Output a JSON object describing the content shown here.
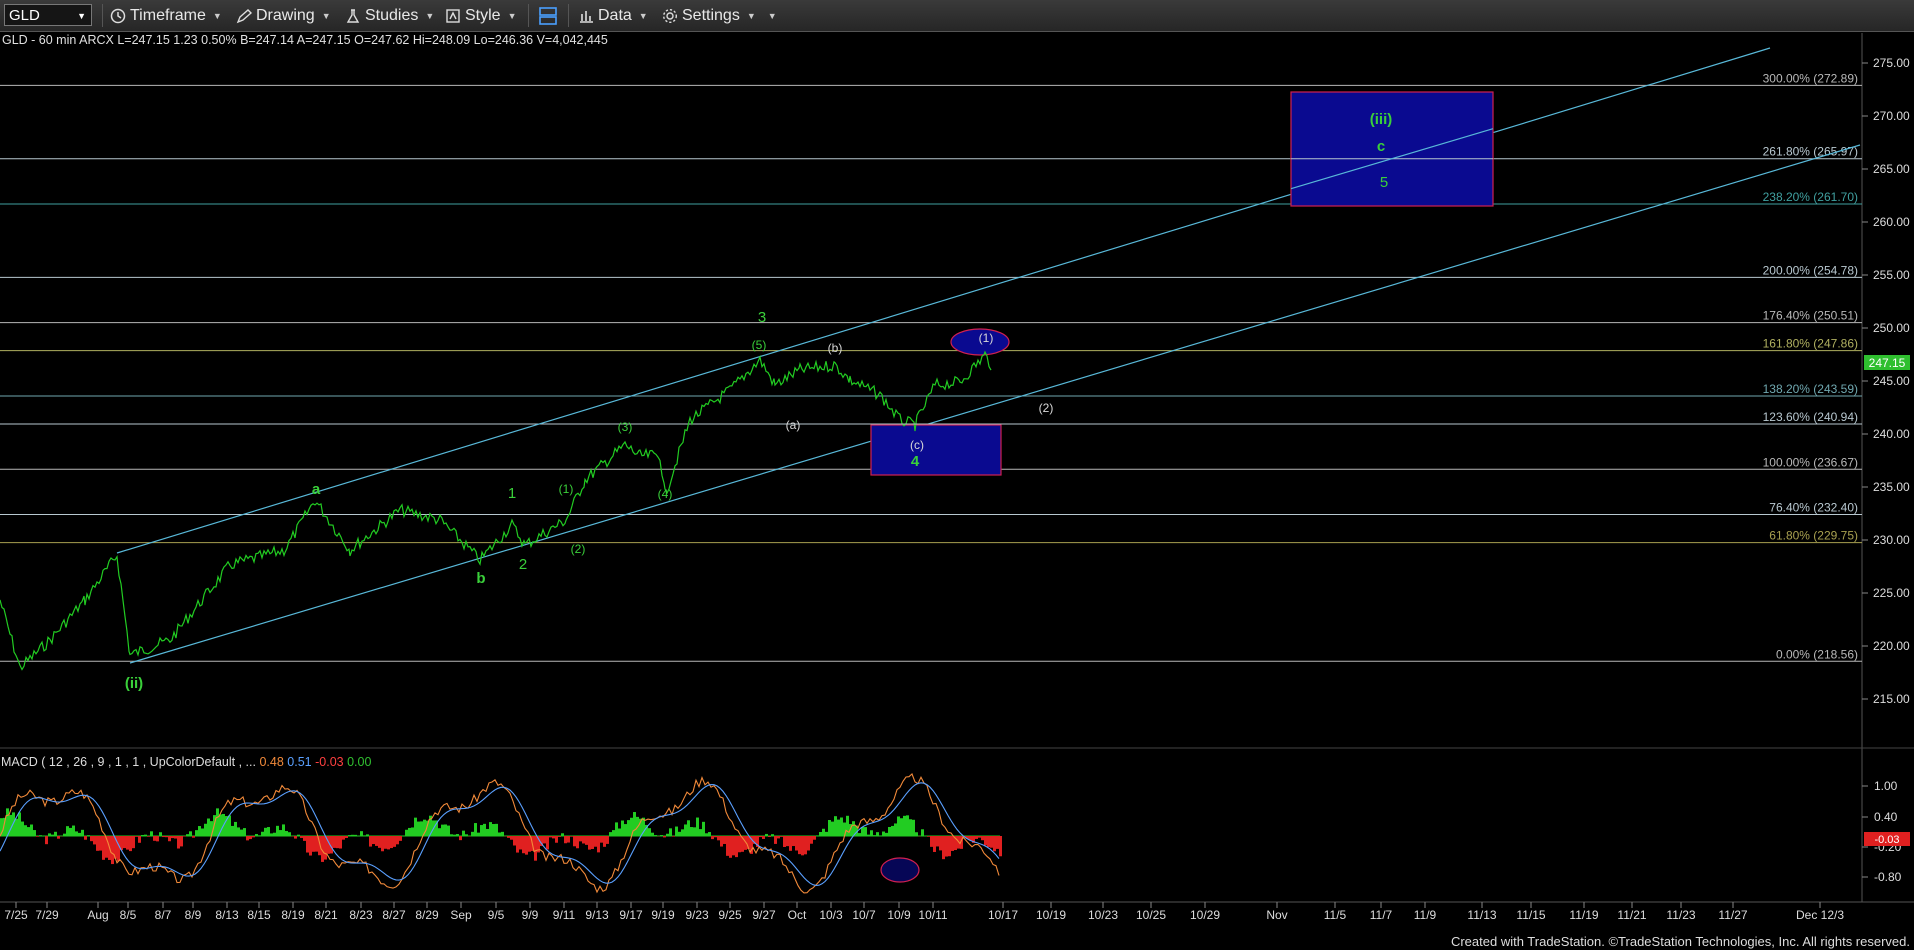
{
  "toolbar": {
    "symbol": "GLD",
    "timeframe": "Timeframe",
    "drawing": "Drawing",
    "studies": "Studies",
    "style": "Style",
    "data": "Data",
    "settings": "Settings"
  },
  "header": {
    "symbol_info": "GLD - 60 min  ARCX",
    "last": "L=247.15",
    "change": "1.23",
    "change_pct": "0.50%",
    "bid": "B=247.14",
    "ask": "A=247.15",
    "open": "O=247.62",
    "high": "Hi=248.09",
    "low": "Lo=246.36",
    "volume": "V=4,042,445"
  },
  "price_axis": {
    "ticks": [
      "275.00",
      "270.00",
      "265.00",
      "260.00",
      "255.00",
      "250.00",
      "245.00",
      "240.00",
      "235.00",
      "230.00",
      "225.00",
      "220.00",
      "215.00"
    ],
    "last_price": "247.15",
    "colors": {
      "last_price_bg": "#2fbf2f"
    }
  },
  "fib_levels": [
    {
      "label": "300.00% (272.89)",
      "value": 272.89,
      "color": "#b8b8b8"
    },
    {
      "label": "261.80% (265.97)",
      "value": 265.97,
      "color": "#b8c8d0"
    },
    {
      "label": "238.20% (261.70)",
      "value": 261.7,
      "color": "#40a0a0"
    },
    {
      "label": "200.00% (254.78)",
      "value": 254.78,
      "color": "#b8c8d0"
    },
    {
      "label": "176.40% (250.51)",
      "value": 250.51,
      "color": "#b8b8b8"
    },
    {
      "label": "161.80% (247.86)",
      "value": 247.86,
      "color": "#b0b060"
    },
    {
      "label": "138.20% (243.59)",
      "value": 243.59,
      "color": "#70a8b0"
    },
    {
      "label": "123.60% (240.94)",
      "value": 240.94,
      "color": "#b8c8d0"
    },
    {
      "label": "100.00% (236.67)",
      "value": 236.67,
      "color": "#b8b8b8"
    },
    {
      "label": "76.40% (232.40)",
      "value": 232.4,
      "color": "#b8c8d0"
    },
    {
      "label": "61.80% (229.75)",
      "value": 229.75,
      "color": "#a8a050"
    },
    {
      "label": "0.00% (218.56)",
      "value": 218.56,
      "color": "#b8b8b8"
    }
  ],
  "wave_labels_green": [
    "(iii)",
    "c",
    "5",
    "3",
    "(5)",
    "(3)",
    "(4)",
    "a",
    "1",
    "(1)",
    "2",
    "(2)",
    "b",
    "(ii)",
    "4"
  ],
  "wave_labels_white": [
    "(1)",
    "(b)",
    "(a)",
    "(2)",
    "(c)"
  ],
  "macd": {
    "title": "MACD ( 12 , 26 , 9 , 1 , 1 , UpColorDefault , ...",
    "macd_value": "0.48",
    "signal_value": "0.51",
    "diff_value": "-0.03",
    "zero_value": "0.00",
    "axis_ticks": [
      "1.00",
      "0.40",
      "-0.20",
      "-0.80"
    ],
    "last_diff_tag": "-0.03",
    "colors": {
      "macd": "#f28a3a",
      "signal": "#5aa0ff",
      "up": "#22cc22",
      "down": "#e02020"
    }
  },
  "date_axis": [
    "7/25",
    "7/29",
    "Aug",
    "8/5",
    "8/7",
    "8/9",
    "8/13",
    "8/15",
    "8/19",
    "8/21",
    "8/23",
    "8/27",
    "8/29",
    "Sep",
    "9/5",
    "9/9",
    "9/11",
    "9/13",
    "9/17",
    "9/19",
    "9/23",
    "9/25",
    "9/27",
    "Oct",
    "10/3",
    "10/7",
    "10/9",
    "10/11",
    "10/17",
    "10/19",
    "10/23",
    "10/25",
    "10/29",
    "Nov",
    "11/5",
    "11/7",
    "11/9",
    "11/13",
    "11/15",
    "11/19",
    "11/21",
    "11/23",
    "11/27",
    "Dec 12/3"
  ],
  "footer": {
    "credit": "Created with TradeStation. ©TradeStation Technologies, Inc. All rights reserved."
  }
}
